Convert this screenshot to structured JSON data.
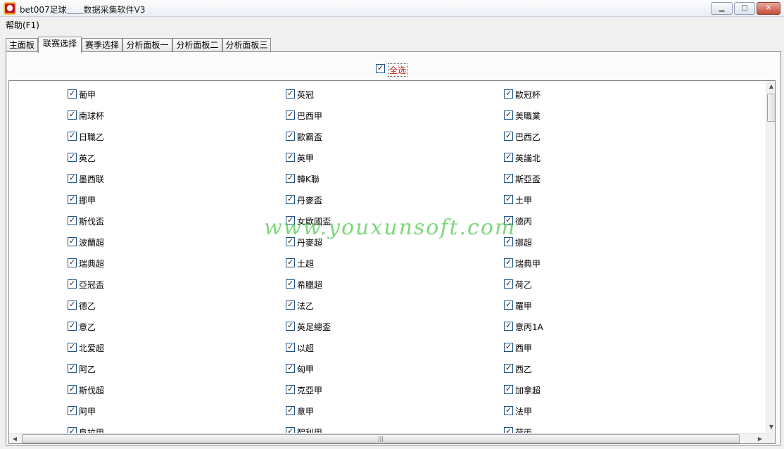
{
  "window": {
    "title": "bet007足球＿＿数据采集软件V3",
    "minimize_glyph": "▁",
    "maximize_glyph": "□",
    "close_glyph": "✕"
  },
  "menu": {
    "help": "帮助(F1)"
  },
  "tabs": [
    {
      "label": "主面板"
    },
    {
      "label": "联赛选择",
      "active": true
    },
    {
      "label": "赛季选择"
    },
    {
      "label": "分析面板一"
    },
    {
      "label": "分析面板二"
    },
    {
      "label": "分析面板三"
    }
  ],
  "select_all": {
    "label": "全选",
    "checked": true
  },
  "leagues": {
    "column1": [
      "葡甲",
      "南球杯",
      "日職乙",
      "英乙",
      "墨西联",
      "挪甲",
      "斯伐盃",
      "波蘭超",
      "瑞典超",
      "亞冠盃",
      "德乙",
      "意乙",
      "北爱超",
      "阿乙",
      "斯伐超",
      "阿甲",
      "阜拉甲"
    ],
    "column2": [
      "英冠",
      "巴西甲",
      "歐霸盃",
      "英甲",
      "韓K聯",
      "丹麥盃",
      "女歐國盃",
      "丹麥超",
      "土超",
      "希臘超",
      "法乙",
      "英足總盃",
      "以超",
      "匈甲",
      "克亞甲",
      "意甲",
      "智利甲"
    ],
    "column3": [
      "歐冠杯",
      "美職業",
      "巴西乙",
      "英議北",
      "斯亞盃",
      "土甲",
      "德丙",
      "挪超",
      "瑞典甲",
      "荷乙",
      "羅甲",
      "意丙1A",
      "西甲",
      "西乙",
      "加拿超",
      "法甲",
      "荷丙"
    ]
  },
  "watermark": "www.youxunsoft.com",
  "icons": {
    "app": "app-logo-icon",
    "scroll_up": "▲",
    "scroll_down": "▼",
    "scroll_left": "◀",
    "scroll_right": "▶",
    "grip": "|||"
  }
}
